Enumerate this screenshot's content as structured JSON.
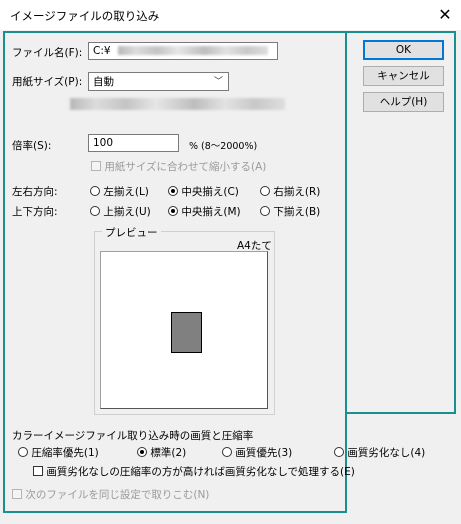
{
  "window": {
    "title": "イメージファイルの取り込み",
    "close_glyph": "✕"
  },
  "file": {
    "label": "ファイル名(F):",
    "value": "C:¥"
  },
  "paper": {
    "label": "用紙サイズ(P):",
    "value": "自動"
  },
  "scale": {
    "label": "倍率(S):",
    "value": "100",
    "unit": "% (8〜2000%)",
    "fit_checkbox": "用紙サイズに合わせて縮小する(A)"
  },
  "horizontal": {
    "label": "左右方向:",
    "options": [
      "左揃え(L)",
      "中央揃え(C)",
      "右揃え(R)"
    ],
    "selected_index": 1
  },
  "vertical": {
    "label": "上下方向:",
    "options": [
      "上揃え(U)",
      "中央揃え(M)",
      "下揃え(B)"
    ],
    "selected_index": 1
  },
  "preview": {
    "label": "プレビュー",
    "paper_label": "A4たて"
  },
  "quality": {
    "heading": "カラーイメージファイル取り込み時の画質と圧縮率",
    "options": [
      "圧縮率優先(1)",
      "標準(2)",
      "画質優先(3)",
      "画質劣化なし(4)"
    ],
    "selected_index": 1,
    "lossless_checkbox": "画質劣化なしの圧縮率の方が高ければ画質劣化なしで処理する(E)"
  },
  "same_settings_checkbox": "次のファイルを同じ設定で取りこむ(N)",
  "buttons": {
    "ok": "OK",
    "cancel": "キャンセル",
    "help": "ヘルプ(H)"
  },
  "colors": {
    "highlight": "#1a8f8f",
    "default_button_border": "#0078d7"
  }
}
